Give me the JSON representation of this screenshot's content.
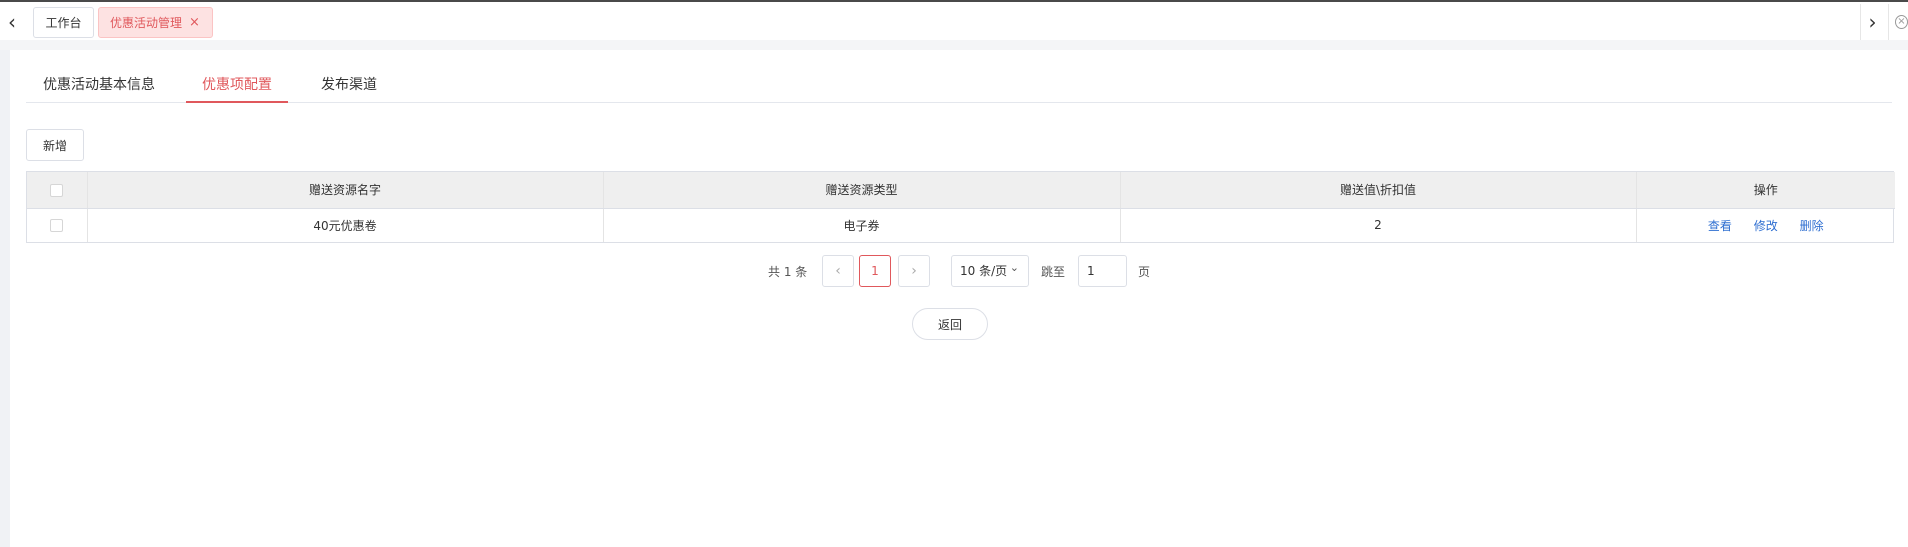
{
  "topbar": {
    "prev_icon": "chevron-left-icon",
    "next_icon": "chevron-right-icon",
    "close_all_icon": "close-circle-icon",
    "tabs": [
      {
        "label": "工作台"
      },
      {
        "label": "优惠活动管理",
        "close": "×"
      }
    ]
  },
  "subtabs": {
    "items": [
      {
        "label": "优惠活动基本信息"
      },
      {
        "label": "优惠项配置"
      },
      {
        "label": "发布渠道"
      }
    ],
    "active_index": 1
  },
  "toolbar": {
    "add_label": "新增"
  },
  "table": {
    "columns": [
      "赠送资源名字",
      "赠送资源类型",
      "赠送值\\折扣值",
      "操作"
    ],
    "rows": [
      {
        "name": "40元优惠卷",
        "type": "电子券",
        "value": "2",
        "actions": [
          "查看",
          "修改",
          "删除"
        ]
      }
    ]
  },
  "pagination": {
    "total_text": "共 1 条",
    "current_page": "1",
    "page_size": "10 条/页",
    "goto_label": "跳至",
    "goto_value": "1",
    "page_suffix": "页"
  },
  "footer": {
    "back_label": "返回"
  },
  "colors": {
    "accent": "#e0585c",
    "link": "#2f6fd1"
  }
}
